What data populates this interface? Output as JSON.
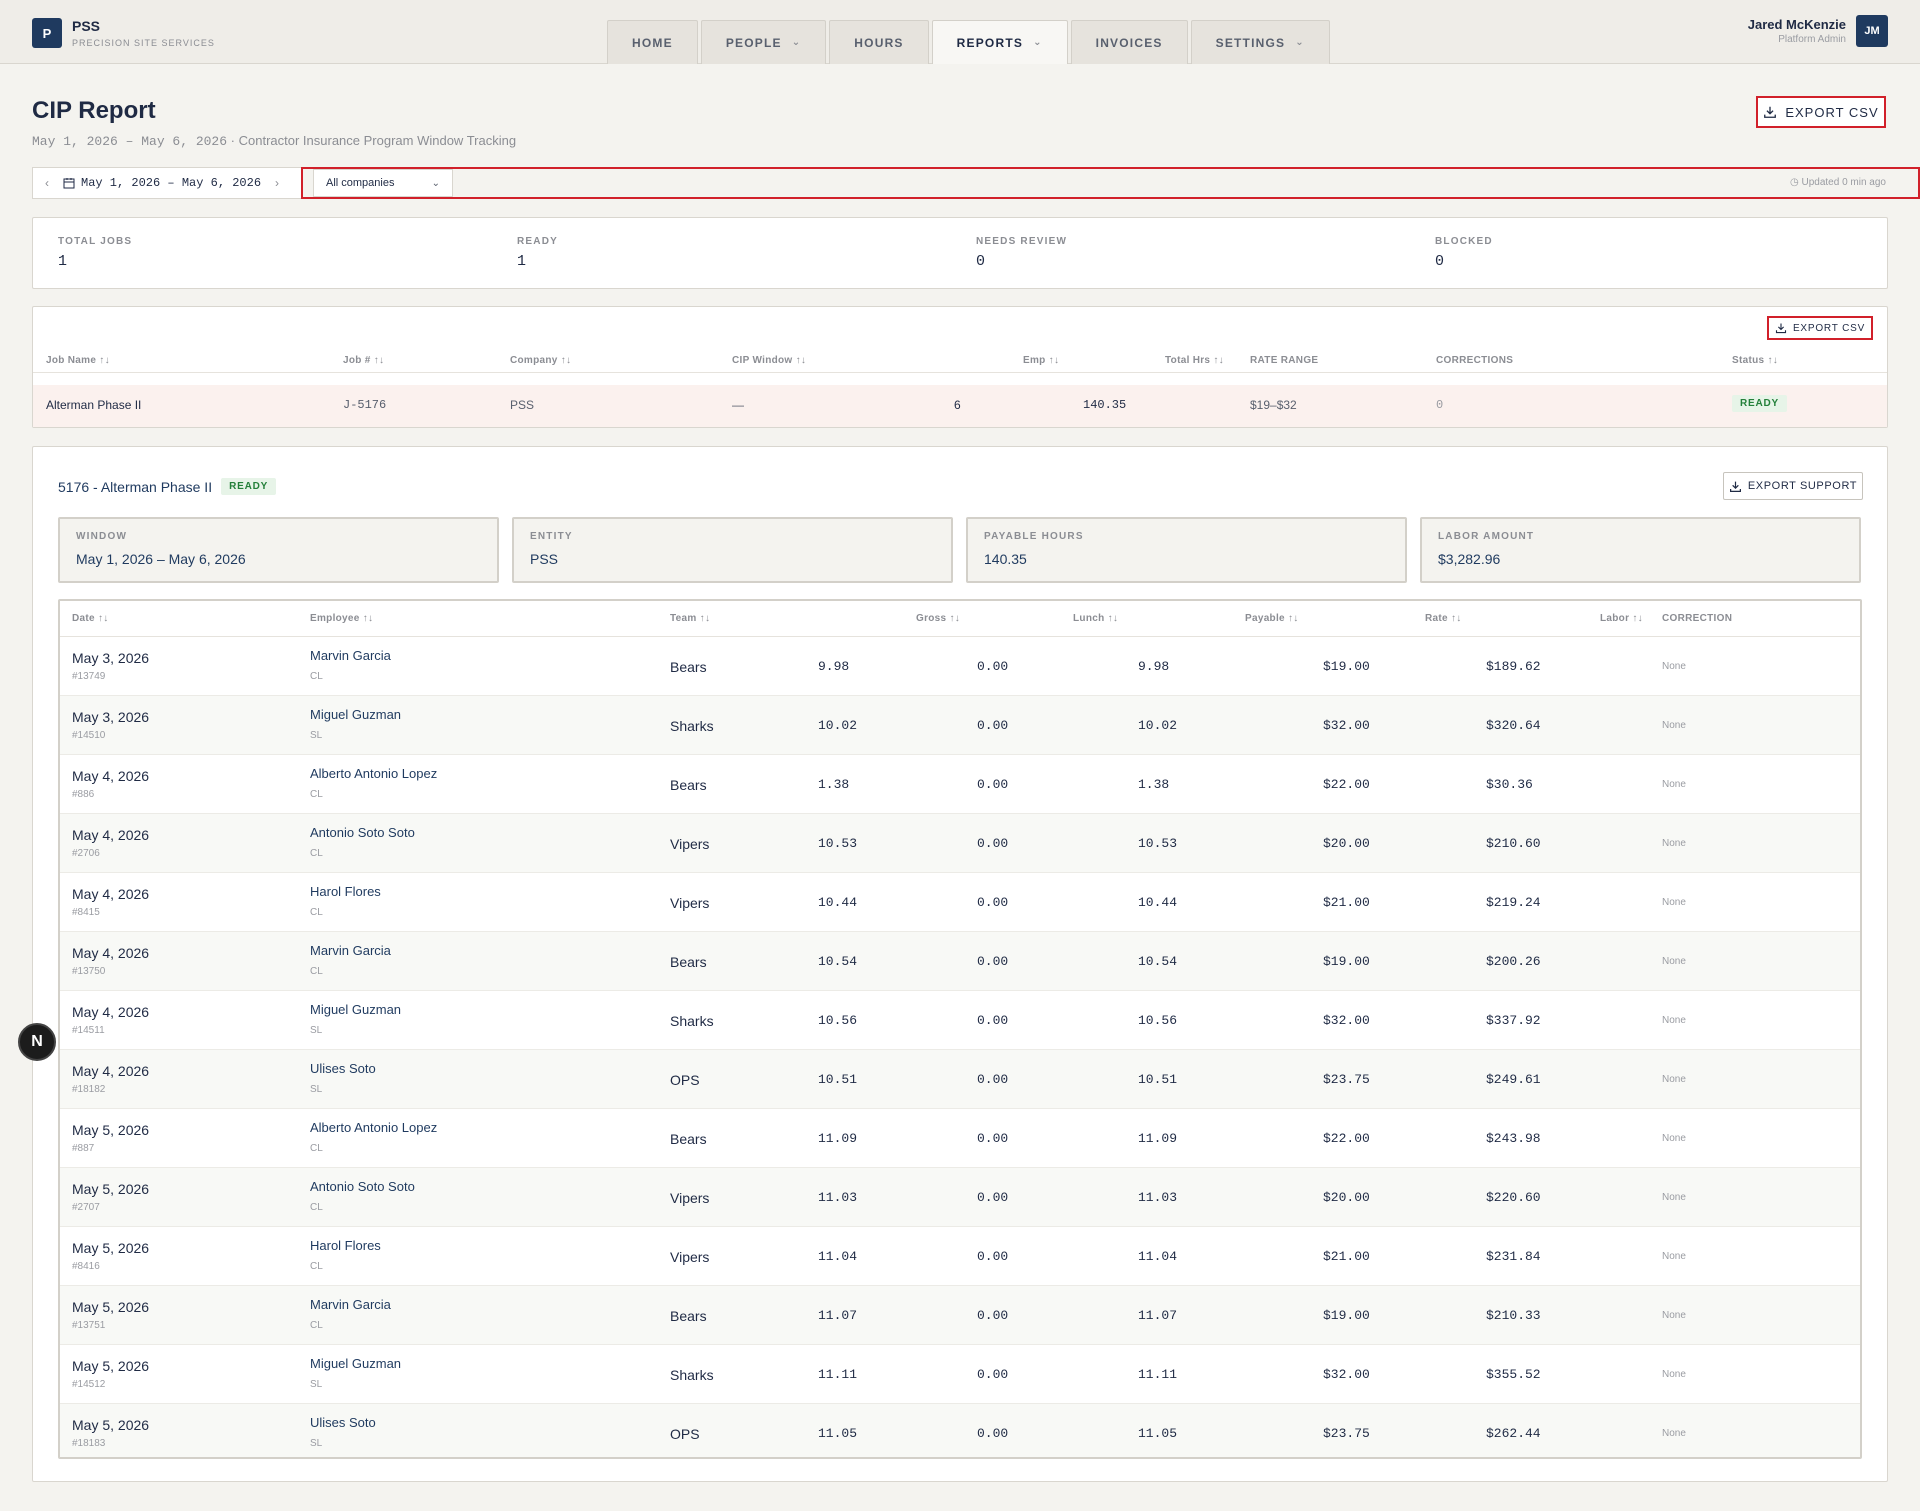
{
  "brand": {
    "logo_letter": "P",
    "name": "PSS",
    "subtitle": "PRECISION SITE SERVICES"
  },
  "nav": [
    {
      "label": "HOME",
      "dropdown": false,
      "active": false
    },
    {
      "label": "PEOPLE",
      "dropdown": true,
      "active": false
    },
    {
      "label": "HOURS",
      "dropdown": false,
      "active": false
    },
    {
      "label": "REPORTS",
      "dropdown": true,
      "active": true
    },
    {
      "label": "INVOICES",
      "dropdown": false,
      "active": false
    },
    {
      "label": "SETTINGS",
      "dropdown": true,
      "active": false
    }
  ],
  "user": {
    "name": "Jared McKenzie",
    "role": "Platform Admin",
    "initials": "JM"
  },
  "header": {
    "title": "CIP Report",
    "range": "May 1, 2026 – May 6, 2026",
    "description": "· Contractor Insurance Program Window Tracking",
    "export_label": "EXPORT CSV"
  },
  "filters": {
    "date_range": "May 1, 2026 – May 6, 2026",
    "company": "All companies",
    "updated": "Updated 0 min ago"
  },
  "stats": [
    {
      "label": "TOTAL JOBS",
      "value": "1"
    },
    {
      "label": "READY",
      "value": "1"
    },
    {
      "label": "NEEDS REVIEW",
      "value": "0"
    },
    {
      "label": "BLOCKED",
      "value": "0"
    }
  ],
  "jobs": {
    "export_label": "EXPORT CSV",
    "columns": [
      "Job Name ↑↓",
      "Job # ↑↓",
      "Company ↑↓",
      "CIP Window ↑↓",
      "Emp ↑↓",
      "Total Hrs ↑↓",
      "RATE RANGE",
      "CORRECTIONS",
      "Status ↑↓"
    ],
    "row": {
      "name": "Alterman Phase II",
      "number": "J-5176",
      "company": "PSS",
      "window": "—",
      "emp": "6",
      "total_hrs": "140.35",
      "rate_range": "$19–$32",
      "corrections": "0",
      "status": "READY"
    }
  },
  "detail": {
    "title": "5176 - Alterman Phase II",
    "status": "READY",
    "export_label": "EXPORT SUPPORT",
    "cards": [
      {
        "label": "WINDOW",
        "value": "May 1, 2026 – May 6, 2026"
      },
      {
        "label": "ENTITY",
        "value": "PSS"
      },
      {
        "label": "PAYABLE HOURS",
        "value": "140.35"
      },
      {
        "label": "LABOR AMOUNT",
        "value": "$3,282.96"
      }
    ],
    "columns": [
      "Date ↑↓",
      "Employee ↑↓",
      "Team ↑↓",
      "Gross ↑↓",
      "Lunch ↑↓",
      "Payable ↑↓",
      "Rate ↑↓",
      "Labor ↑↓",
      "CORRECTION"
    ],
    "rows": [
      {
        "date": "May 3, 2026",
        "id": "#13749",
        "employee": "Marvin Garcia",
        "role": "CL",
        "team": "Bears",
        "gross": "9.98",
        "lunch": "0.00",
        "payable": "9.98",
        "rate": "$19.00",
        "labor": "$189.62",
        "correction": "None"
      },
      {
        "date": "May 3, 2026",
        "id": "#14510",
        "employee": "Miguel Guzman",
        "role": "SL",
        "team": "Sharks",
        "gross": "10.02",
        "lunch": "0.00",
        "payable": "10.02",
        "rate": "$32.00",
        "labor": "$320.64",
        "correction": "None"
      },
      {
        "date": "May 4, 2026",
        "id": "#886",
        "employee": "Alberto Antonio Lopez",
        "role": "CL",
        "team": "Bears",
        "gross": "1.38",
        "lunch": "0.00",
        "payable": "1.38",
        "rate": "$22.00",
        "labor": "$30.36",
        "correction": "None"
      },
      {
        "date": "May 4, 2026",
        "id": "#2706",
        "employee": "Antonio Soto Soto",
        "role": "CL",
        "team": "Vipers",
        "gross": "10.53",
        "lunch": "0.00",
        "payable": "10.53",
        "rate": "$20.00",
        "labor": "$210.60",
        "correction": "None"
      },
      {
        "date": "May 4, 2026",
        "id": "#8415",
        "employee": "Harol Flores",
        "role": "CL",
        "team": "Vipers",
        "gross": "10.44",
        "lunch": "0.00",
        "payable": "10.44",
        "rate": "$21.00",
        "labor": "$219.24",
        "correction": "None"
      },
      {
        "date": "May 4, 2026",
        "id": "#13750",
        "employee": "Marvin Garcia",
        "role": "CL",
        "team": "Bears",
        "gross": "10.54",
        "lunch": "0.00",
        "payable": "10.54",
        "rate": "$19.00",
        "labor": "$200.26",
        "correction": "None"
      },
      {
        "date": "May 4, 2026",
        "id": "#14511",
        "employee": "Miguel Guzman",
        "role": "SL",
        "team": "Sharks",
        "gross": "10.56",
        "lunch": "0.00",
        "payable": "10.56",
        "rate": "$32.00",
        "labor": "$337.92",
        "correction": "None"
      },
      {
        "date": "May 4, 2026",
        "id": "#18182",
        "employee": "Ulises Soto",
        "role": "SL",
        "team": "OPS",
        "gross": "10.51",
        "lunch": "0.00",
        "payable": "10.51",
        "rate": "$23.75",
        "labor": "$249.61",
        "correction": "None"
      },
      {
        "date": "May 5, 2026",
        "id": "#887",
        "employee": "Alberto Antonio Lopez",
        "role": "CL",
        "team": "Bears",
        "gross": "11.09",
        "lunch": "0.00",
        "payable": "11.09",
        "rate": "$22.00",
        "labor": "$243.98",
        "correction": "None"
      },
      {
        "date": "May 5, 2026",
        "id": "#2707",
        "employee": "Antonio Soto Soto",
        "role": "CL",
        "team": "Vipers",
        "gross": "11.03",
        "lunch": "0.00",
        "payable": "11.03",
        "rate": "$20.00",
        "labor": "$220.60",
        "correction": "None"
      },
      {
        "date": "May 5, 2026",
        "id": "#8416",
        "employee": "Harol Flores",
        "role": "CL",
        "team": "Vipers",
        "gross": "11.04",
        "lunch": "0.00",
        "payable": "11.04",
        "rate": "$21.00",
        "labor": "$231.84",
        "correction": "None"
      },
      {
        "date": "May 5, 2026",
        "id": "#13751",
        "employee": "Marvin Garcia",
        "role": "CL",
        "team": "Bears",
        "gross": "11.07",
        "lunch": "0.00",
        "payable": "11.07",
        "rate": "$19.00",
        "labor": "$210.33",
        "correction": "None"
      },
      {
        "date": "May 5, 2026",
        "id": "#14512",
        "employee": "Miguel Guzman",
        "role": "SL",
        "team": "Sharks",
        "gross": "11.11",
        "lunch": "0.00",
        "payable": "11.11",
        "rate": "$32.00",
        "labor": "$355.52",
        "correction": "None"
      },
      {
        "date": "May 5, 2026",
        "id": "#18183",
        "employee": "Ulises Soto",
        "role": "SL",
        "team": "OPS",
        "gross": "11.05",
        "lunch": "0.00",
        "payable": "11.05",
        "rate": "$23.75",
        "labor": "$262.44",
        "correction": "None"
      }
    ]
  },
  "floating_badge": "N",
  "colors": {
    "accent": "#1f3a5f",
    "highlight": "#d1202a",
    "ready": "#24803a"
  }
}
